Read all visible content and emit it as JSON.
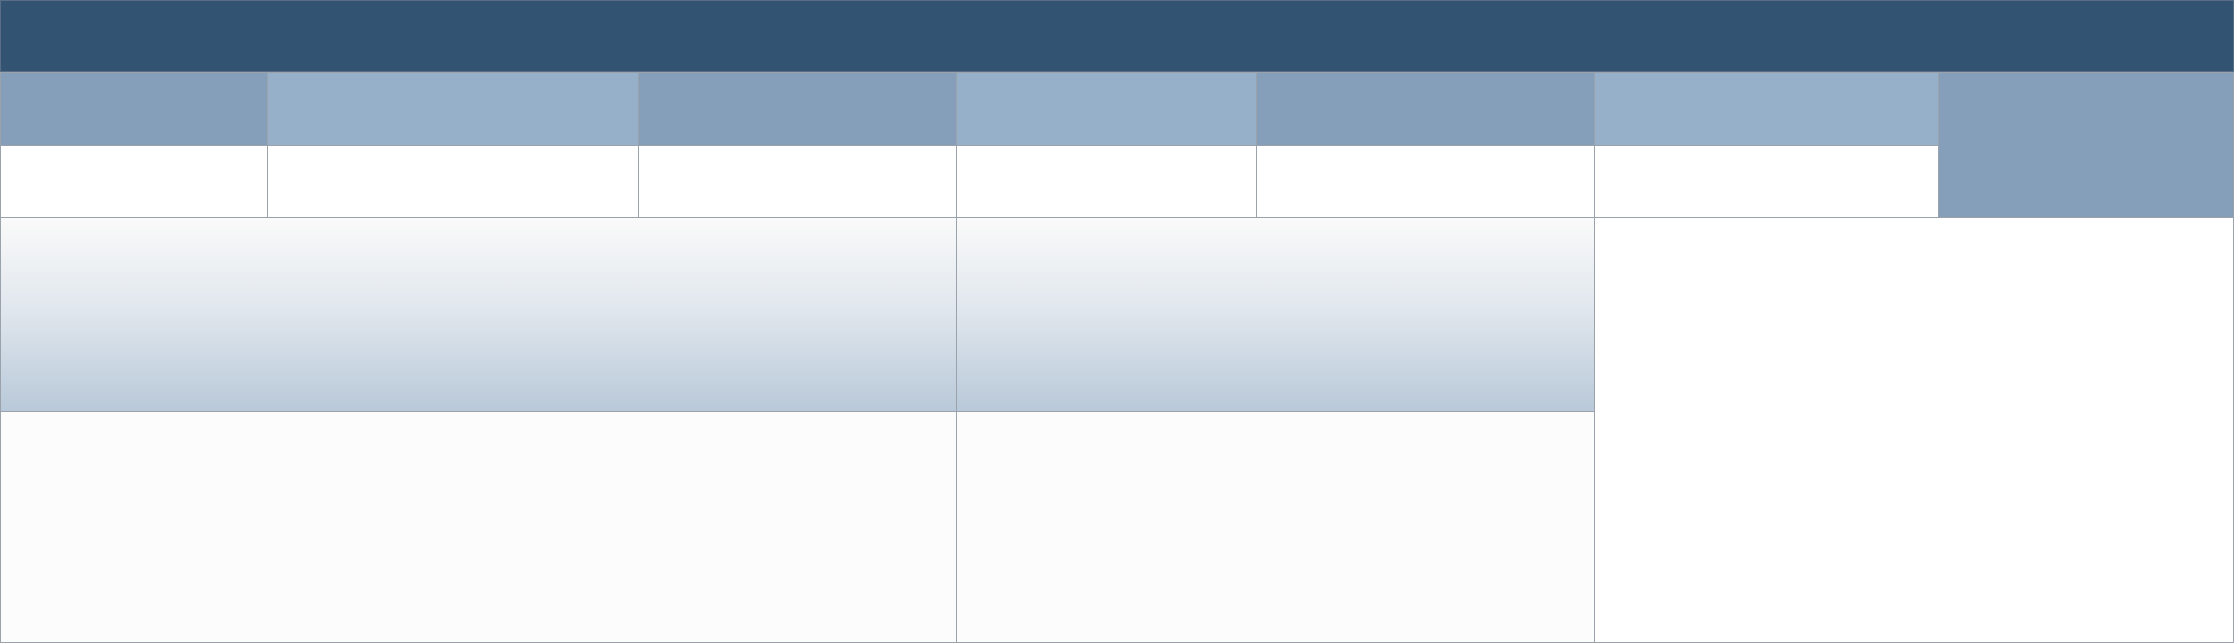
{
  "form": {
    "title": "",
    "header_row": {
      "col1": "",
      "col2": "",
      "col3": "",
      "col4": "",
      "col5": "",
      "col6": "",
      "col7": ""
    },
    "value_row": {
      "col1": "",
      "col2": "",
      "col3": "",
      "col4": "",
      "col5": "",
      "col6": ""
    },
    "sections": {
      "left_heading": "",
      "left_body": "",
      "middle_heading": "",
      "middle_body": "",
      "right_body": ""
    }
  },
  "colors": {
    "title_bar": "#335373",
    "header_dark": "#859fba",
    "header_light": "#95b0c8",
    "border": "#9aa3ab",
    "section_gradient_bottom": "#b9c9d9",
    "section_body": "#fcfcfc"
  }
}
